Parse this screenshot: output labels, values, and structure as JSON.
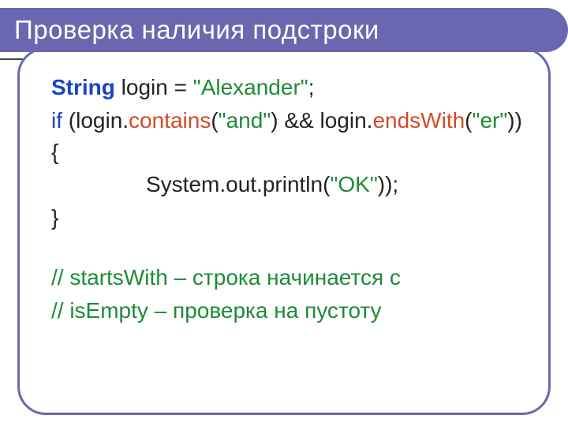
{
  "slide": {
    "title": "Проверка наличия подстроки"
  },
  "code": {
    "kw_string": "String",
    "var_login": " login = ",
    "str_alexander": "\"Alexander\"",
    "semi": ";",
    "kw_if": "if",
    "if_open": " (login.",
    "m_contains": "contains",
    "contains_arg_open": "(",
    "str_and": "\"and\"",
    "contains_close": ") && login.",
    "m_endswith": "endsWith",
    "endswith_arg_open": "(",
    "str_er": "\"er\"",
    "endswith_close": ")) {",
    "println_pre": "System.out.println(",
    "str_ok": "\"OK\"",
    "println_post": "));",
    "brace_close": "}",
    "comment1": "// startsWith – строка начинается с",
    "comment2": "// isEmpty – проверка на пустоту"
  }
}
